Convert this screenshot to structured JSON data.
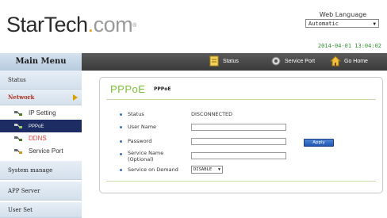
{
  "header": {
    "logo": {
      "star": "StarTech",
      "dot": ".",
      "com": "com",
      "reg": "®"
    },
    "web_language_label": "Web Language",
    "web_language_value": "Automatic",
    "datetime": "2014-04-01 13:04:02"
  },
  "sidebar": {
    "title": "Main Menu",
    "items": [
      {
        "label": "Status"
      },
      {
        "label": "Network"
      },
      {
        "label": "System manage"
      },
      {
        "label": "APP Server"
      },
      {
        "label": "User Set"
      }
    ],
    "network_sub": [
      {
        "label": "IP Setting",
        "icon": "network-settings-icon"
      },
      {
        "label": "PPPoE",
        "icon": "pppoe-icon"
      },
      {
        "label": "DDNS",
        "icon": "ddns-icon"
      },
      {
        "label": "Service Port",
        "icon": "service-port-icon"
      }
    ]
  },
  "topnav": [
    {
      "label": "Status",
      "icon": "status-icon"
    },
    {
      "label": "Service Port",
      "icon": "service-port-icon"
    },
    {
      "label": "Go Home",
      "icon": "home-icon"
    }
  ],
  "panel": {
    "title": "PPPoE",
    "subtitle": "PPPoE",
    "rows": [
      {
        "label": "Status",
        "value": "DISCONNECTED"
      },
      {
        "label": "User Name",
        "value": ""
      },
      {
        "label": "Password",
        "value": ""
      },
      {
        "label": "Service Name (Optional)",
        "value": ""
      },
      {
        "label": "Service on Demand",
        "value": "DISABLE"
      }
    ],
    "apply_label": "Apply"
  },
  "colors": {
    "accent_green": "#7cbf3a",
    "nav_dark": "#3a3a3a",
    "active_item": "#1d2d63",
    "apply_blue": "#2f6cc6"
  }
}
